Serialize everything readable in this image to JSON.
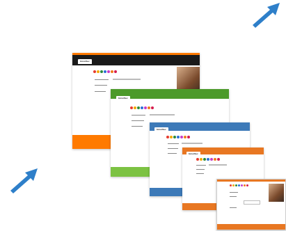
{
  "windows": [
    {
      "id": "w1",
      "tab_label": "Innoltec",
      "theme": "#1a1a1a",
      "accent": "#ff7a00"
    },
    {
      "id": "w2",
      "tab_label": "Innoltec",
      "theme": "#4c9a2a",
      "accent": "#7cc242"
    },
    {
      "id": "w3",
      "tab_label": "Innoltec",
      "theme": "#3d7ab8",
      "accent": "#3d7ab8"
    },
    {
      "id": "w4",
      "tab_label": "Innoltec",
      "theme": "#e87722",
      "accent": "#e87722"
    },
    {
      "id": "w5",
      "tab_label": "Innoltec",
      "theme": "#ffffff",
      "accent": "#e87722"
    }
  ],
  "icon_colors": [
    "#e63b2e",
    "#f2a900",
    "#2a8a3a",
    "#2a6fd6",
    "#c63cc6",
    "#f07a1a",
    "#d61c4e"
  ],
  "arrows": {
    "color": "#2e7fc9"
  }
}
